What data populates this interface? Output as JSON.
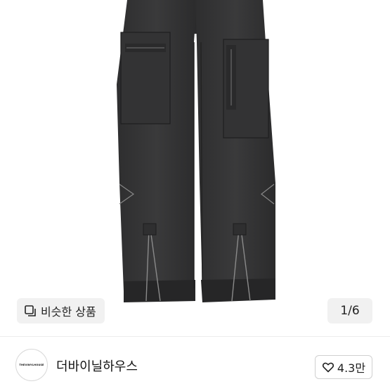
{
  "product": {
    "similar_label": "비슷한 상품",
    "image_counter": "1/6"
  },
  "seller": {
    "name": "더바이닐하우스",
    "avatar_text": "THEVINYLHOUSE"
  },
  "like": {
    "count": "4.3만"
  },
  "icons": {
    "similar": "similar-items-icon",
    "heart": "heart-icon"
  }
}
